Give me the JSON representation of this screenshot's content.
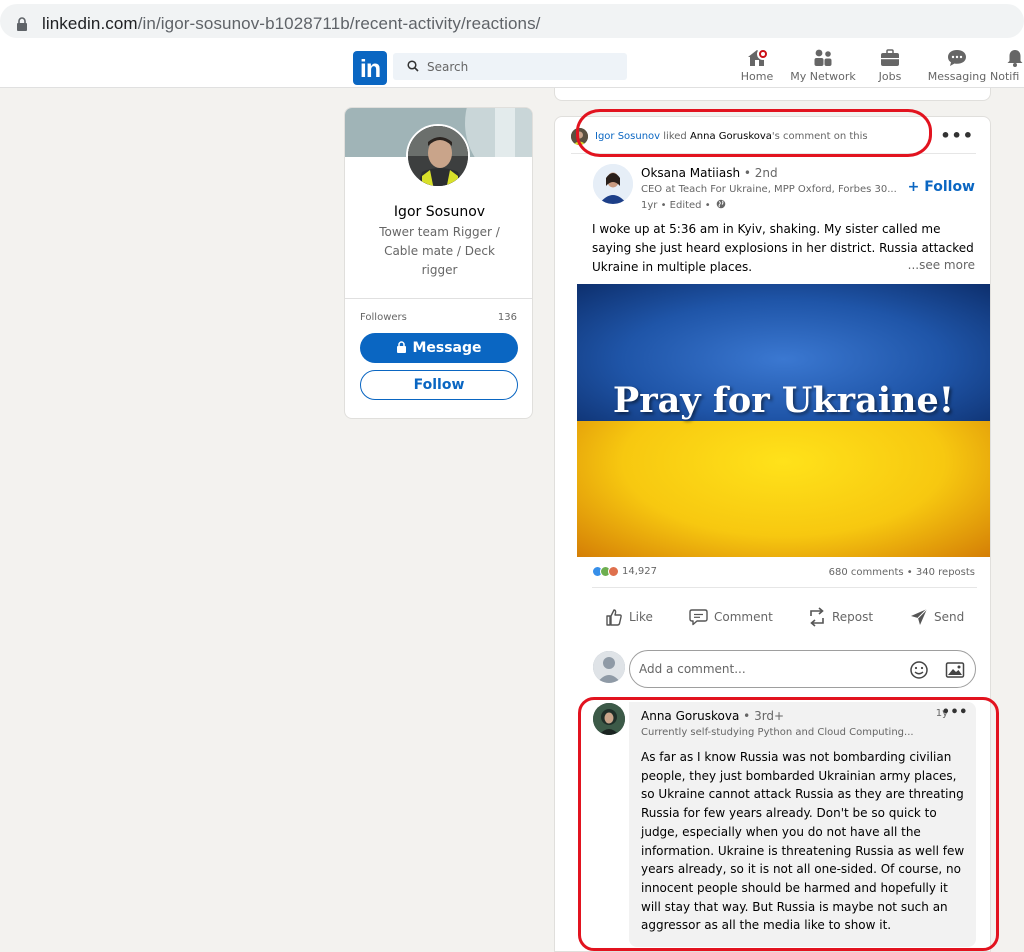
{
  "browser": {
    "url_domain": "linkedin.com",
    "url_path": "/in/igor-sosunov-b1028711b/recent-activity/reactions/"
  },
  "nav": {
    "logo": "in",
    "search_placeholder": "Search",
    "items": [
      {
        "label": "Home",
        "icon": "home-icon"
      },
      {
        "label": "My Network",
        "icon": "network-icon"
      },
      {
        "label": "Jobs",
        "icon": "jobs-icon"
      },
      {
        "label": "Messaging",
        "icon": "messaging-icon"
      },
      {
        "label": "Notifi",
        "icon": "notifications-icon"
      }
    ]
  },
  "profile": {
    "name": "Igor Sosunov",
    "headline": "Tower team Rigger / Cable mate / Deck rigger",
    "followers_label": "Followers",
    "followers_count": "136",
    "message_label": "Message",
    "follow_label": "Follow"
  },
  "activity": {
    "actor": "Igor Sosunov",
    "verb": "liked",
    "target": "Anna Goruskova",
    "suffix": "'s comment on this"
  },
  "post": {
    "author": "Oksana Matiiash",
    "degree": "• 2nd",
    "headline": "CEO at Teach For Ukraine, MPP Oxford, Forbes 30...",
    "meta": "1yr • Edited •",
    "follow_label": "+ Follow",
    "text": "I woke up at 5:36 am in Kyiv, shaking. My sister called me saying she just heard explosions in her district. Russia attacked Ukraine in multiple places.",
    "see_more": "...see more",
    "image_text": "Pray  for Ukraine!",
    "reaction_count": "14,927",
    "comments_reposts": "680 comments • 340 reposts",
    "actions": [
      "Like",
      "Comment",
      "Repost",
      "Send"
    ],
    "comment_placeholder": "Add a comment..."
  },
  "comment": {
    "author": "Anna Goruskova",
    "degree": "• 3rd+",
    "headline": "Currently self-studying Python and Cloud Computing...",
    "time": "1y",
    "text": "As far as I know Russia was not bombarding civilian people, they just bombarded Ukrainian army places, so Ukraine cannot attack Russia as they are threating Russia for few years already. Don't be so quick to judge, especially when you do not have all the information. Ukraine is threatening Russia as well few years already, so it is not all one-sided. Of course, no innocent people should be harmed and hopefully it will stay that way. But Russia is maybe not such an aggressor as all the media like to show it."
  },
  "colors": {
    "linkedin_blue": "#0a66c2",
    "annotation_red": "#e2131f",
    "flag_blue": "#1f55a8",
    "flag_yellow": "#f7c810"
  }
}
